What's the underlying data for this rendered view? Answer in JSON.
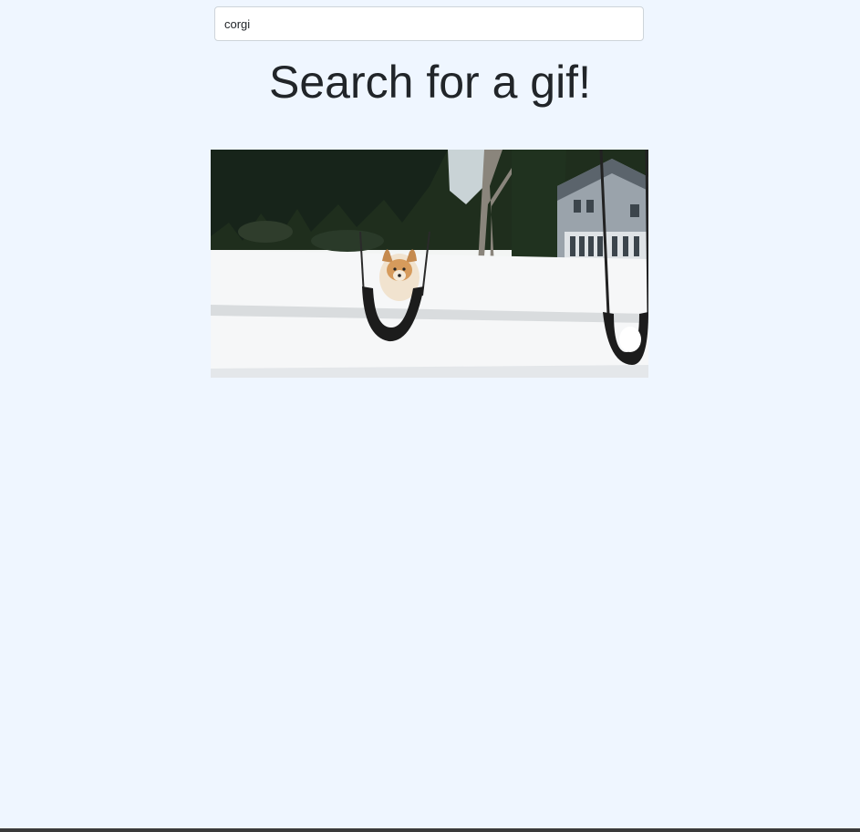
{
  "search": {
    "value": "corgi",
    "placeholder": ""
  },
  "page": {
    "title": "Search for a gif!"
  },
  "results": {
    "gif_subject": "corgi-on-swing-in-snow"
  },
  "colors": {
    "background": "#eff6ff",
    "title_text": "#212529",
    "input_border": "#ced4da"
  }
}
